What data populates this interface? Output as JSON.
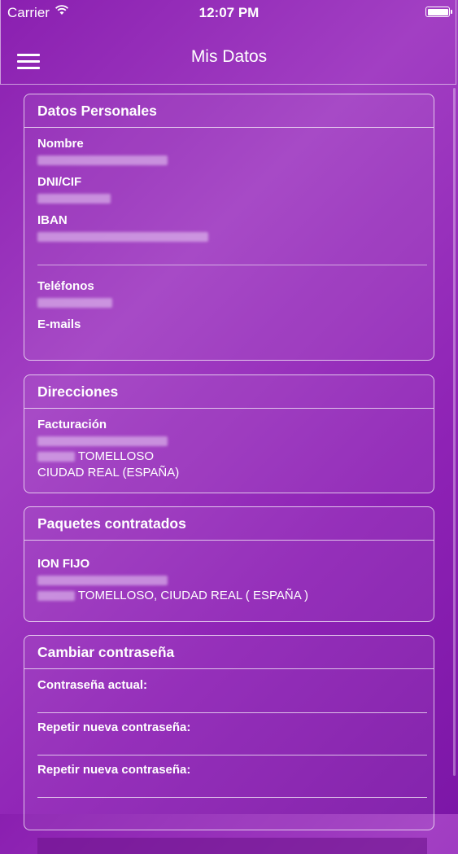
{
  "status_bar": {
    "carrier": "Carrier",
    "time": "12:07 PM"
  },
  "nav": {
    "title": "Mis Datos",
    "menu_icon": "hamburger-menu-icon"
  },
  "personal": {
    "title": "Datos Personales",
    "nombre_label": "Nombre",
    "dni_label": "DNI/CIF",
    "iban_label": "IBAN",
    "telefonos_label": "Teléfonos",
    "emails_label": "E-mails"
  },
  "direcciones": {
    "title": "Direcciones",
    "facturacion_label": "Facturación",
    "city": "TOMELLOSO",
    "region": "CIUDAD REAL (ESPAÑA)"
  },
  "paquetes": {
    "title": "Paquetes contratados",
    "package_name": "ION FIJO",
    "address_line": "TOMELLOSO, CIUDAD REAL ( ESPAÑA )"
  },
  "password": {
    "title": "Cambiar contraseña",
    "current_label": "Contraseña actual:",
    "new_label": "Repetir nueva contraseña:",
    "repeat_label": "Repetir nueva contraseña:"
  }
}
